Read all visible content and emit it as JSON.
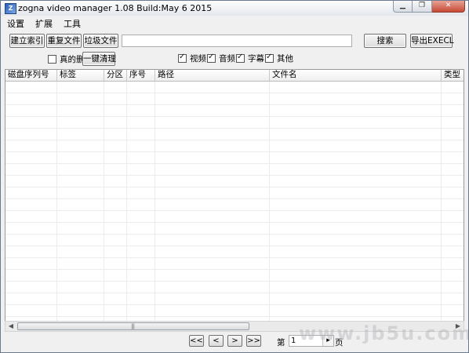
{
  "window": {
    "title": "zogna video manager 1.08 Build:May  6 2015",
    "app_icon_glyph": "Z",
    "minimize_glyph": "▁",
    "maximize_glyph": "❐",
    "close_glyph": "✕"
  },
  "menu": [
    "设置",
    "扩展",
    "工具"
  ],
  "toolbar": {
    "build_index": "建立索引",
    "duplicate_files": "重复文件",
    "trash_files": "垃圾文件",
    "search_value": "",
    "search_button": "搜索",
    "export_button": "导出EXECL",
    "really_delete": "真的删",
    "one_click_clean": "一键清理"
  },
  "filters": [
    {
      "label": "视频",
      "checked": true
    },
    {
      "label": "音频",
      "checked": true
    },
    {
      "label": "字幕",
      "checked": true
    },
    {
      "label": "其他",
      "checked": true
    }
  ],
  "checkbox_tick": "✓",
  "table": {
    "columns": [
      "磁盘序列号",
      "标签",
      "分区",
      "序号",
      "路径",
      "文件名",
      "类型"
    ],
    "rows": []
  },
  "scrollbar": {
    "left_arrow": "◀",
    "right_arrow": "▶",
    "grip": "|||"
  },
  "pager": {
    "first": "<<",
    "prev": "<",
    "next": ">",
    "last": ">>",
    "page_prefix": "第",
    "page_value": "1",
    "page_suffix": "页",
    "spin_glyph": "▸"
  },
  "watermark": "www.jb5u.com"
}
